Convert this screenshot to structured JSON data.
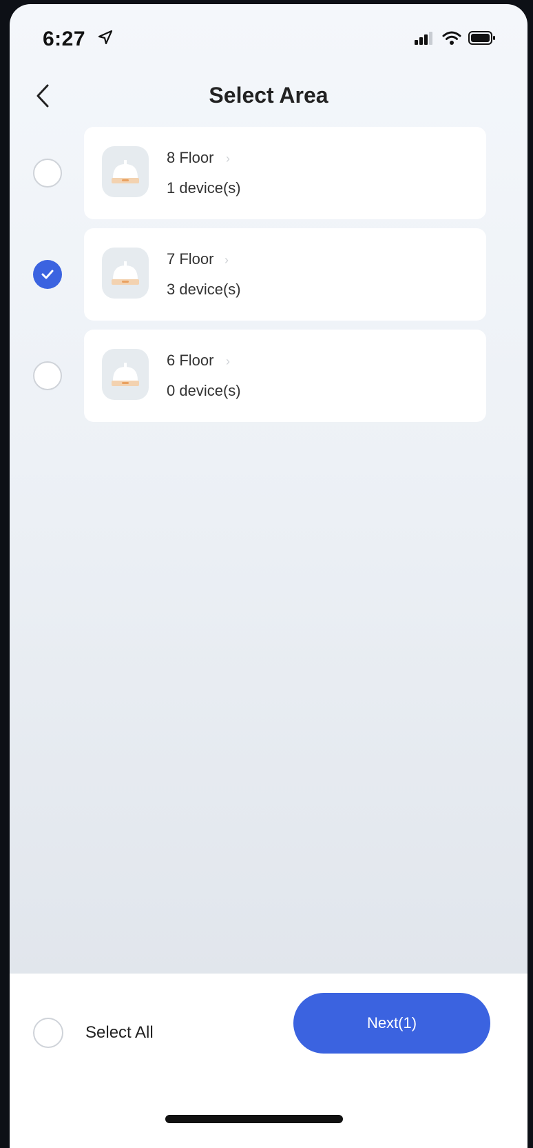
{
  "status_bar": {
    "time": "6:27",
    "location_icon": "location-arrow-icon",
    "signal_icon": "cellular-signal-icon",
    "wifi_icon": "wifi-icon",
    "battery_icon": "battery-icon"
  },
  "header": {
    "title": "Select Area",
    "back_icon": "chevron-left-icon"
  },
  "areas": [
    {
      "name": "8 Floor",
      "devices": "1 device(s)",
      "selected": false,
      "icon": "lamp-icon"
    },
    {
      "name": "7 Floor",
      "devices": "3 device(s)",
      "selected": true,
      "icon": "lamp-icon"
    },
    {
      "name": "6 Floor",
      "devices": "0 device(s)",
      "selected": false,
      "icon": "lamp-icon"
    }
  ],
  "footer": {
    "select_all_label": "Select All",
    "next_label": "Next(1)"
  },
  "colors": {
    "accent": "#3b63e0",
    "card": "#ffffff",
    "lamp": "#f2a24e"
  }
}
